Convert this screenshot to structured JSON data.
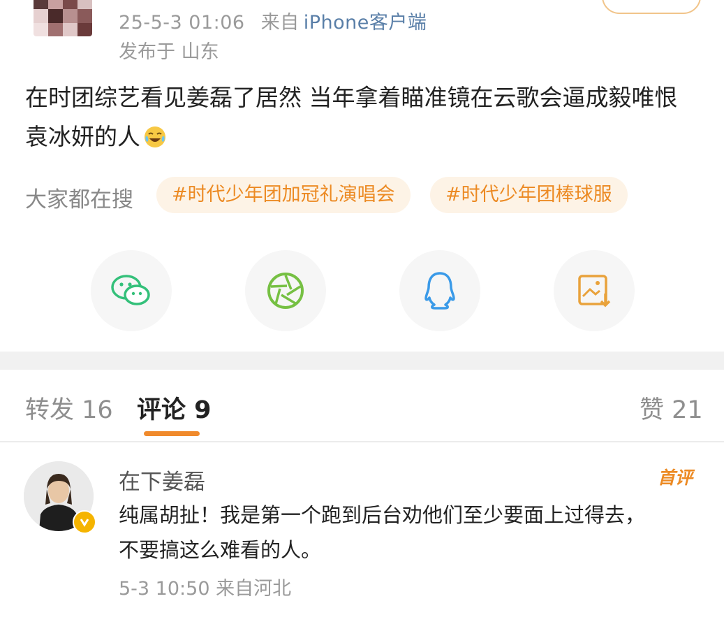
{
  "post": {
    "time": "25-5-3 01:06",
    "source_prefix": "来自",
    "source": "iPhone客户端",
    "location": "发布于 山东",
    "text_line1": "在时团综艺看见姜磊了居然 当年拿着瞄准镜在云歌会逼成毅唯恨",
    "text_line2": "袁冰妍的人",
    "emoji": "laughing-crying-emoji"
  },
  "search": {
    "label": "大家都在搜",
    "tags": [
      "#时代少年团加冠礼演唱会",
      "#时代少年团棒球服"
    ]
  },
  "share": {
    "icons": [
      "wechat-icon",
      "moments-icon",
      "qq-icon",
      "save-image-icon"
    ],
    "colors": {
      "wechat": "#34c07a",
      "moments": "#76c043",
      "qq": "#3a9ae8",
      "save": "#e9a23b"
    }
  },
  "tabs": [
    {
      "label": "转发 16"
    },
    {
      "label": "评论 9"
    },
    {
      "label": "赞 21"
    }
  ],
  "comment": {
    "author": "在下姜磊",
    "badge": "首评",
    "text_line1": "纯属胡扯！我是第一个跑到后台劝他们至少要面上过得去，",
    "text_line2": "不要搞这么难看的人。",
    "meta": "5-3 10:50 来自河北"
  },
  "colors": {
    "accent": "#f08a2c",
    "tag_bg": "#fdf3e6",
    "tag_text": "#ec8a23",
    "link": "#5a7fa8"
  }
}
